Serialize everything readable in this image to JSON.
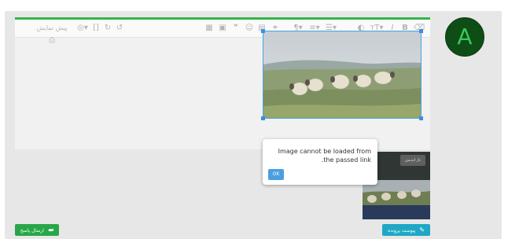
{
  "avatar": {
    "letter": "A",
    "bg": "#0f4d17",
    "fg": "#37c85c"
  },
  "editor": {
    "accent": "#37b34a",
    "toolbar": {
      "preview_label": "پیش نمایش",
      "icons": [
        "preview-icon",
        "camera-icon",
        "code-icon",
        "redo-icon",
        "undo-icon",
        "table-icon",
        "image-icon",
        "quote-icon",
        "emoji-icon",
        "video-icon",
        "link-icon",
        "paragraph-icon",
        "align-icon",
        "list-icon",
        "color-icon",
        "font-size-icon",
        "italic-icon",
        "bold-icon",
        "clear-format-icon"
      ]
    }
  },
  "popup": {
    "message": "Image cannot be loaded from the passed link.",
    "ok_label": "OK"
  },
  "attachment": {
    "badge": "تاژ اندیش"
  },
  "buttons": {
    "attach_label": "پیوست پرونده",
    "send_label": "ارسال پاسخ"
  }
}
